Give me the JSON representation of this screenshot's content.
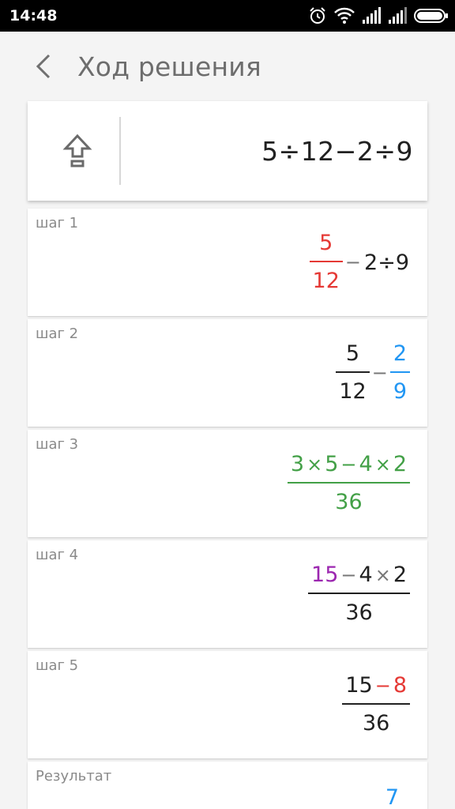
{
  "status_bar": {
    "time": "14:48"
  },
  "header": {
    "title": "Ход решения"
  },
  "expression": "5÷12−2÷9",
  "steps": [
    {
      "label": "шаг 1",
      "frac_num": "5",
      "frac_den": "12",
      "op": "−",
      "rest": "2÷9"
    },
    {
      "label": "шаг 2",
      "left_num": "5",
      "left_den": "12",
      "op": "−",
      "right_num": "2",
      "right_den": "9"
    },
    {
      "label": "шаг 3",
      "num_a": "3",
      "num_times1": "×",
      "num_b": "5",
      "num_minus": "−",
      "num_c": "4",
      "num_times2": "×",
      "num_d": "2",
      "den": "36"
    },
    {
      "label": "шаг 4",
      "num_a": "15",
      "num_minus": "−",
      "num_c": "4",
      "num_times": "×",
      "num_d": "2",
      "den": "36"
    },
    {
      "label": "шаг 5",
      "num_a": "15",
      "num_minus": "−",
      "num_b": "8",
      "den": "36"
    }
  ],
  "result": {
    "label": "Результат",
    "value_partial": "7"
  },
  "colors": {
    "red": "#e53935",
    "blue": "#2196f3",
    "green": "#43a047",
    "purple": "#9c27b0"
  },
  "icons": [
    "alarm-clock-icon",
    "wifi-icon",
    "signal-icon",
    "battery-icon",
    "back-arrow-icon",
    "arrow-up-icon"
  ]
}
